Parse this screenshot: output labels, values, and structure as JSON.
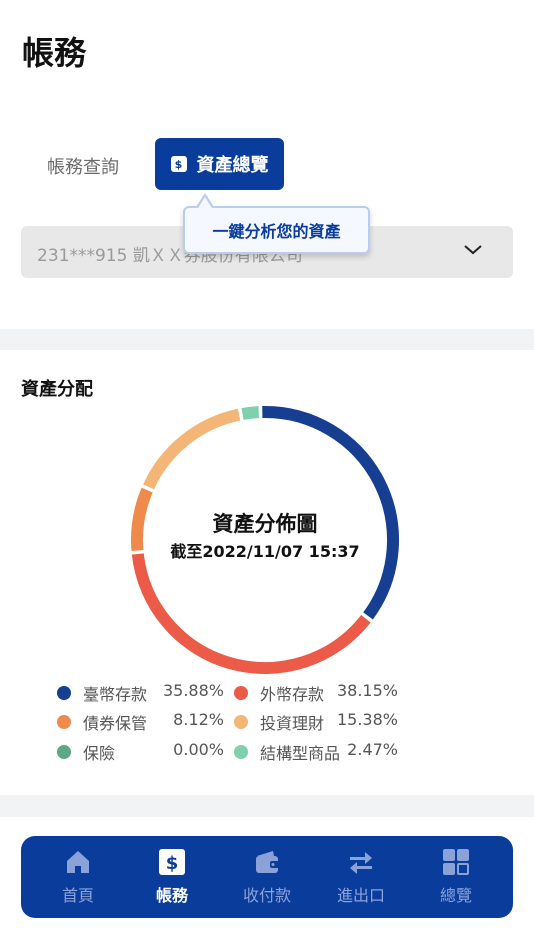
{
  "header": {
    "title": "帳務"
  },
  "tabs": [
    {
      "label": "帳務查詢",
      "active": false
    },
    {
      "label": "資產總覽",
      "active": true,
      "icon": "dollar-icon"
    }
  ],
  "tooltip": {
    "text": "一鍵分析您的資產"
  },
  "account_select": {
    "value": "231***915 凱ＸＸ券股份有限公司"
  },
  "asset_section": {
    "title": "資產分配",
    "chart_center": {
      "title": "資產分佈圖",
      "as_of": "截至2022/11/07  15:37"
    }
  },
  "chart_data": {
    "type": "pie",
    "title": "資產分佈圖",
    "categories": [
      "臺幣存款",
      "外幣存款",
      "債券保管",
      "投資理財",
      "保險",
      "結構型商品"
    ],
    "values": [
      35.88,
      38.15,
      8.12,
      15.38,
      0.0,
      2.47
    ],
    "colors": [
      "#163f91",
      "#ec5b47",
      "#f08a4b",
      "#f4b677",
      "#5fa886",
      "#7fd0ad"
    ],
    "unit": "%"
  },
  "legend": [
    {
      "label": "臺幣存款",
      "percent": "35.88%",
      "color": "#163f91"
    },
    {
      "label": "外幣存款",
      "percent": "38.15%",
      "color": "#ec5b47"
    },
    {
      "label": "債券保管",
      "percent": "8.12%",
      "color": "#f08a4b"
    },
    {
      "label": "投資理財",
      "percent": "15.38%",
      "color": "#f4b677"
    },
    {
      "label": "保險",
      "percent": "0.00%",
      "color": "#5fa886"
    },
    {
      "label": "結構型商品",
      "percent": "2.47%",
      "color": "#7fd0ad"
    }
  ],
  "bottom_nav": [
    {
      "label": "首頁",
      "icon": "home-icon",
      "active": false
    },
    {
      "label": "帳務",
      "icon": "dollar-icon",
      "active": true
    },
    {
      "label": "收付款",
      "icon": "wallet-icon",
      "active": false
    },
    {
      "label": "進出口",
      "icon": "transfer-icon",
      "active": false
    },
    {
      "label": "總覽",
      "icon": "grid-icon",
      "active": false
    }
  ],
  "colors": {
    "primary": "#0a3d9b",
    "nav_inactive": "#8aa2d8"
  }
}
